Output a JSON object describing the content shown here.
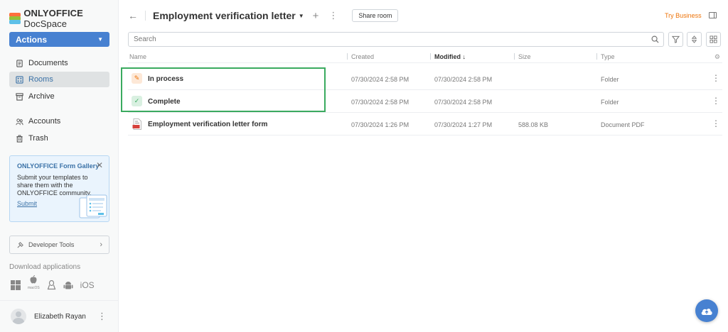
{
  "app": {
    "logo_brand": "ONLYOFFICE",
    "logo_product": "DocSpace"
  },
  "sidebar": {
    "actions_label": "Actions",
    "nav": [
      {
        "label": "Documents",
        "icon": "document-icon",
        "active": false
      },
      {
        "label": "Rooms",
        "icon": "rooms-icon",
        "active": true
      },
      {
        "label": "Archive",
        "icon": "archive-icon",
        "active": false
      },
      {
        "label": "Accounts",
        "icon": "accounts-icon",
        "active": false
      },
      {
        "label": "Trash",
        "icon": "trash-icon",
        "active": false
      }
    ],
    "promo": {
      "title": "ONLYOFFICE Form Gallery",
      "text": "Submit your templates to share them with the ONLYOFFICE community.",
      "link": "Submit"
    },
    "developer_tools": "Developer Tools",
    "download_title": "Download applications",
    "download_apps": [
      "windows",
      "macOS",
      "linux",
      "android",
      "iOS"
    ],
    "macos_label": "macOS",
    "ios_label": "iOS",
    "user_name": "Elizabeth Rayan"
  },
  "header": {
    "title": "Employment verification letter",
    "share_label": "Share room",
    "try_business": "Try Business"
  },
  "search": {
    "placeholder": "Search"
  },
  "table": {
    "columns": {
      "name": "Name",
      "created": "Created",
      "modified": "Modified",
      "size": "Size",
      "type": "Type"
    },
    "rows": [
      {
        "name": "In process",
        "created": "07/30/2024 2:58 PM",
        "modified": "07/30/2024 2:58 PM",
        "size": "",
        "type": "Folder",
        "icon": "pencil-icon"
      },
      {
        "name": "Complete",
        "created": "07/30/2024 2:58 PM",
        "modified": "07/30/2024 2:58 PM",
        "size": "",
        "type": "Folder",
        "icon": "check-icon"
      },
      {
        "name": "Employment verification letter form",
        "created": "07/30/2024 1:26 PM",
        "modified": "07/30/2024 1:27 PM",
        "size": "588.08 KB",
        "type": "Document PDF",
        "icon": "pdf-icon"
      }
    ]
  },
  "colors": {
    "accent": "#4781d1",
    "highlight": "#3aaa5f",
    "try_business": "#ed7309"
  }
}
